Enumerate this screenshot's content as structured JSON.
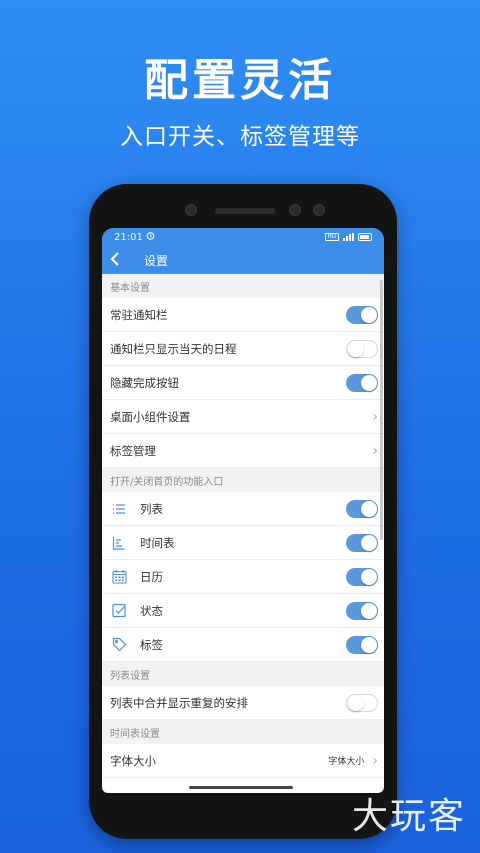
{
  "headline": "配置灵活",
  "subline": "入口开关、标签管理等",
  "status": {
    "time": "21:01",
    "right_badge": "HD"
  },
  "appbar": {
    "title": "设置"
  },
  "sections": {
    "basic": "基本设置",
    "entries": "打开/关闭首页的功能入口",
    "list": "列表设置",
    "timetable": "时间表设置"
  },
  "basic_rows": [
    {
      "label": "常驻通知栏",
      "toggle": "on"
    },
    {
      "label": "通知栏只显示当天的日程",
      "toggle": "off"
    },
    {
      "label": "隐藏完成按钮",
      "toggle": "on"
    },
    {
      "label": "桌面小组件设置",
      "toggle": "none"
    },
    {
      "label": "标签管理",
      "toggle": "none"
    }
  ],
  "entry_rows": [
    {
      "label": "列表",
      "icon": "list-icon",
      "toggle": "on"
    },
    {
      "label": "时间表",
      "icon": "timetable-icon",
      "toggle": "on"
    },
    {
      "label": "日历",
      "icon": "calendar-icon",
      "toggle": "on"
    },
    {
      "label": "状态",
      "icon": "status-check-icon",
      "toggle": "on"
    },
    {
      "label": "标签",
      "icon": "tag-icon",
      "toggle": "on"
    }
  ],
  "list_rows": [
    {
      "label": "列表中合并显示重复的安排",
      "toggle": "off"
    }
  ],
  "timetable_rows": [
    {
      "label": "字体大小",
      "value": "字体大小"
    }
  ],
  "watermark": "大玩客",
  "colors": {
    "accent": "#3c8ee8",
    "toggle_on": "#5b97dc",
    "background": "#2278e9"
  }
}
